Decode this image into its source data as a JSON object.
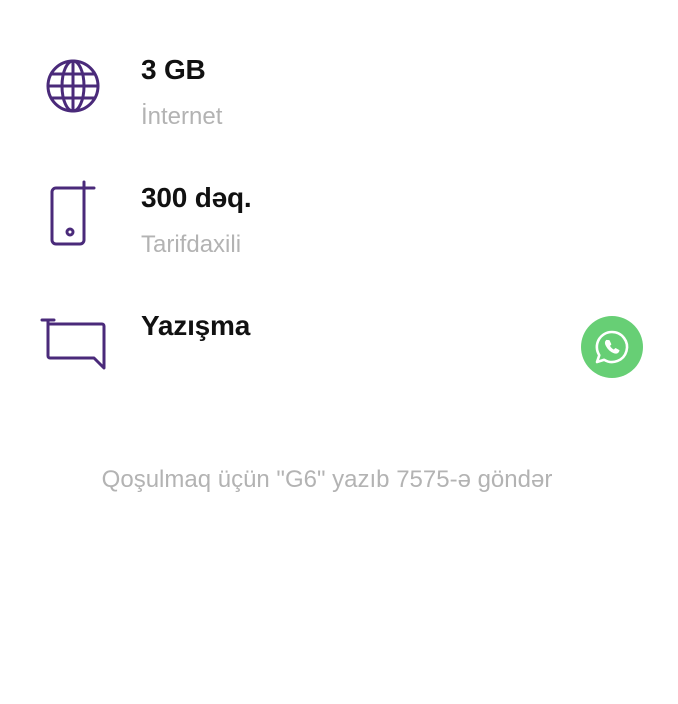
{
  "colors": {
    "icon_stroke": "#4a2a7a",
    "title": "#111111",
    "subtitle": "#b3b3b3",
    "whatsapp": "#67cf75"
  },
  "features": [
    {
      "icon": "globe-icon",
      "title": "3 GB",
      "subtitle": "İnternet"
    },
    {
      "icon": "phone-icon",
      "title": "300 dəq.",
      "subtitle": "Tarifdaxili"
    },
    {
      "icon": "chat-bubble-icon",
      "title": "Yazışma"
    }
  ],
  "messaging_apps": [
    {
      "icon": "whatsapp-icon"
    }
  ],
  "instruction": "Qoşulmaq üçün \"G6\" yazıb 7575-ə göndər"
}
